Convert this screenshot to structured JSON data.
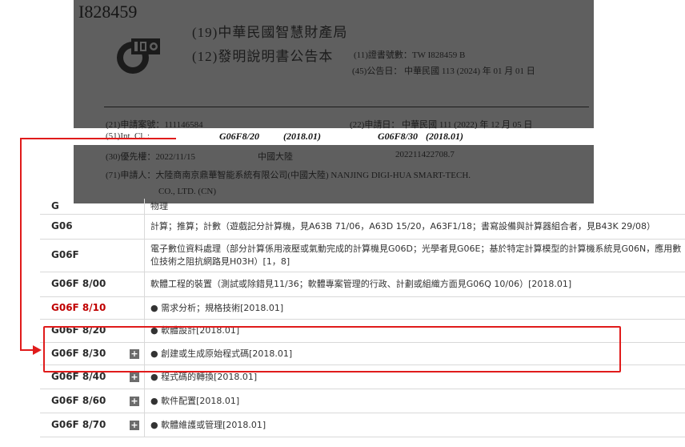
{
  "patent": {
    "patent_number": "I828459",
    "office": "(19)中華民國智慧財產局",
    "kind": "(12)發明說明書公告本",
    "cert_no": "(11)證書號數：TW I828459 B",
    "pub_date": "(45)公告日： 中華民國 113 (2024) 年 01 月 01 日",
    "app_no": "(21)申請案號：111146584",
    "app_date": "(22)申請日： 中華民國 111 (2022) 年 12 月 05 日",
    "int_cl_label": "(51)Int. Cl. :",
    "int_cl": [
      {
        "code": "G06F8/20",
        "date": "(2018.01)"
      },
      {
        "code": "G06F8/30",
        "date": "(2018.01)"
      }
    ],
    "priority": "(30)優先權：2022/11/15",
    "priority_country": "中國大陸",
    "priority_no": "202211422708.7",
    "applicant": "(71)申請人：大陸商南京鼎華智能系統有限公司(中國大陸) NANJING DIGI-HUA SMART-TECH.",
    "applicant_cont": "CO., LTD.    (CN)"
  },
  "classification": {
    "rows": [
      {
        "code": "G",
        "desc": "物理",
        "red": false,
        "expandable": false
      },
      {
        "code": "G06",
        "desc": "計算；推算；計數（遊戲記分計算機，見A63B 71/06，A63D 15/20，A63F1/18；書寫設備與計算器組合者，見B43K 29/08）",
        "red": false,
        "expandable": false
      },
      {
        "code": "G06F",
        "desc": "電子數位資料處理（部分計算係用液壓或氣動完成的計算機見G06D；光學者見G06E；基於特定計算模型的計算機系統見G06N，應用數位技術之阻抗網路見H03H）[1，8]",
        "red": false,
        "expandable": false
      },
      {
        "code": "G06F 8/00",
        "desc": "軟體工程的裝置（測試或除錯見11/36；軟體專案管理的行政、計劃或組織方面見G06Q 10/06）[2018.01]",
        "red": false,
        "expandable": false
      },
      {
        "code": "G06F 8/10",
        "desc": "● 需求分析；規格技術[2018.01]",
        "red": true,
        "expandable": false
      },
      {
        "code": "G06F 8/20",
        "desc": "● 軟體設計[2018.01]",
        "red": false,
        "expandable": false
      },
      {
        "code": "G06F 8/30",
        "desc": "● 創建或生成原始程式碼[2018.01]",
        "red": false,
        "expandable": true
      },
      {
        "code": "G06F 8/40",
        "desc": "● 程式碼的轉換[2018.01]",
        "red": false,
        "expandable": true
      },
      {
        "code": "G06F 8/60",
        "desc": "● 軟件配置[2018.01]",
        "red": false,
        "expandable": true
      },
      {
        "code": "G06F 8/70",
        "desc": "● 軟體維護或管理[2018.01]",
        "red": false,
        "expandable": true
      }
    ],
    "expand_symbol": "+"
  },
  "colors": {
    "annotation": "#e01b1b",
    "red_code": "#c00000",
    "scan_bg": "#5f5f5f"
  }
}
